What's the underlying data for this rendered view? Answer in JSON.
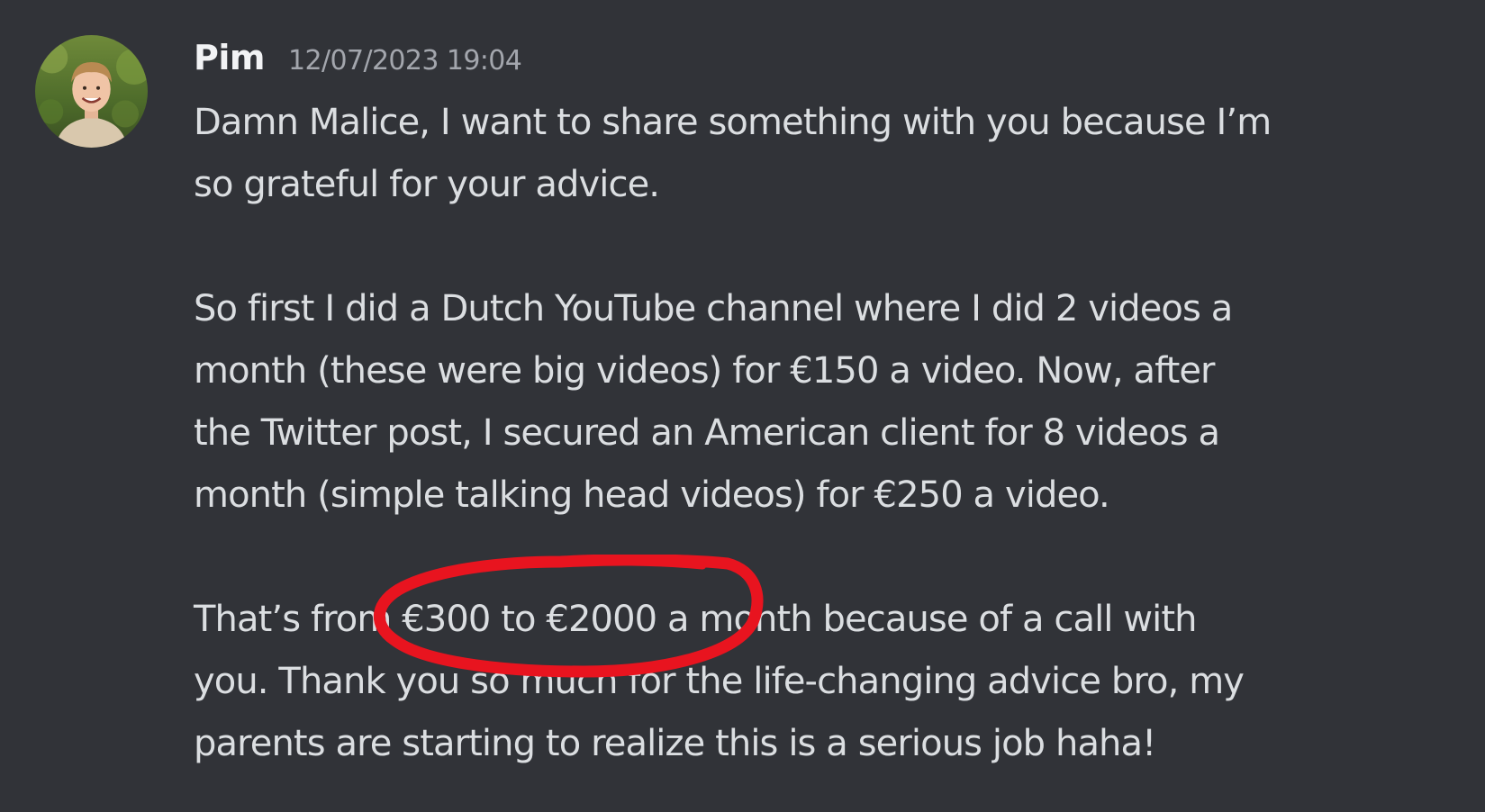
{
  "author": {
    "name": "Pim",
    "timestamp": "12/07/2023 19:04"
  },
  "message": {
    "paragraph_1": [
      "Damn Malice, I want to share something with you because I’m",
      "so grateful for your advice."
    ],
    "paragraph_2": [
      "So first I did a Dutch YouTube channel where I did 2 videos a",
      "month (these were big videos) for €150 a video. Now, after",
      "the Twitter post, I secured an American client for 8 videos a",
      "month (simple talking head videos) for €250 a video."
    ],
    "paragraph_3": [
      "That’s from €300 to €2000 a month because of a call with",
      "you. Thank you so much for the life-changing advice bro, my",
      "parents are starting to realize this is a serious job haha!"
    ]
  },
  "annotation": {
    "type": "circled-text",
    "color": "#e8141f"
  },
  "colors": {
    "background": "#313338",
    "username": "#f2f3f5",
    "timestamp": "#a3a6ad",
    "text": "#dbdee1"
  },
  "icons": {
    "avatar": "user-photo-avatar"
  }
}
